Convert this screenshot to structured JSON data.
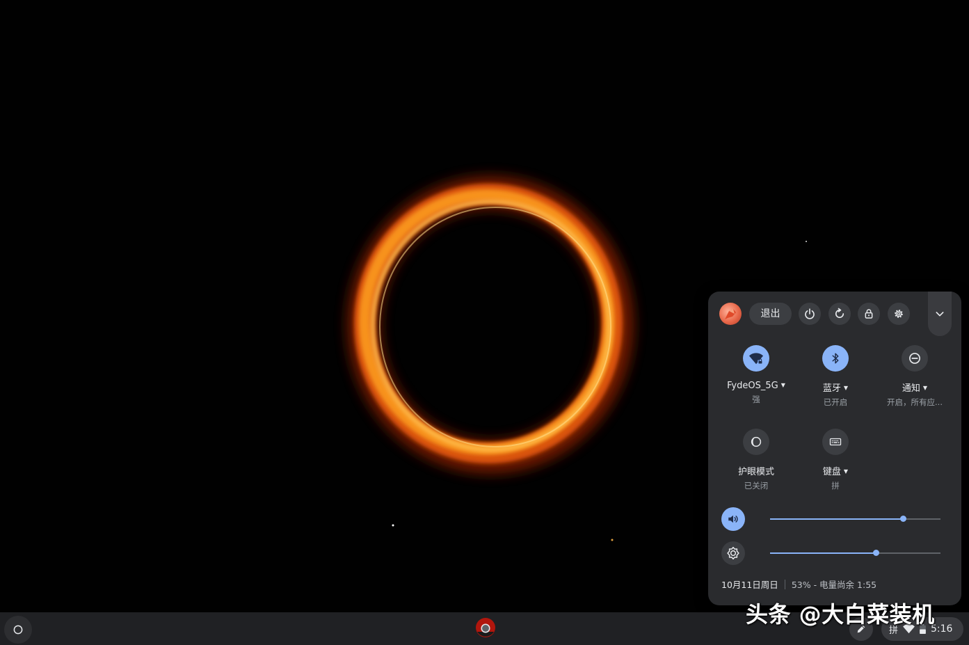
{
  "quick_settings": {
    "signout_label": "退出",
    "tiles": [
      {
        "label": "FydeOS_5G",
        "sublabel": "强",
        "icon": "wifi-lock-icon",
        "active": true,
        "has_dropdown": true
      },
      {
        "label": "蓝牙",
        "sublabel": "已开启",
        "icon": "bluetooth-icon",
        "active": true,
        "has_dropdown": true
      },
      {
        "label": "通知",
        "sublabel": "开启，所有应...",
        "icon": "do-not-disturb-icon",
        "active": false,
        "has_dropdown": true
      },
      {
        "label": "护眼模式",
        "sublabel": "已关闭",
        "icon": "night-light-icon",
        "active": false,
        "has_dropdown": false
      },
      {
        "label": "键盘",
        "sublabel": "拼",
        "icon": "keyboard-icon",
        "active": false,
        "has_dropdown": true
      }
    ],
    "volume_level": 0.78,
    "brightness_level": 0.62,
    "date": "10月11日周日",
    "battery_text": "53% - 电量尚余 1:55"
  },
  "shelf": {
    "ime_indicator": "拼",
    "clock": "5:16"
  },
  "watermark": "头条 @大白菜装机",
  "colors": {
    "accent": "#8ab4f8",
    "panel_bg": "#2a2b2e",
    "button_bg": "#3c3e42",
    "shelf_bg": "#202124"
  }
}
